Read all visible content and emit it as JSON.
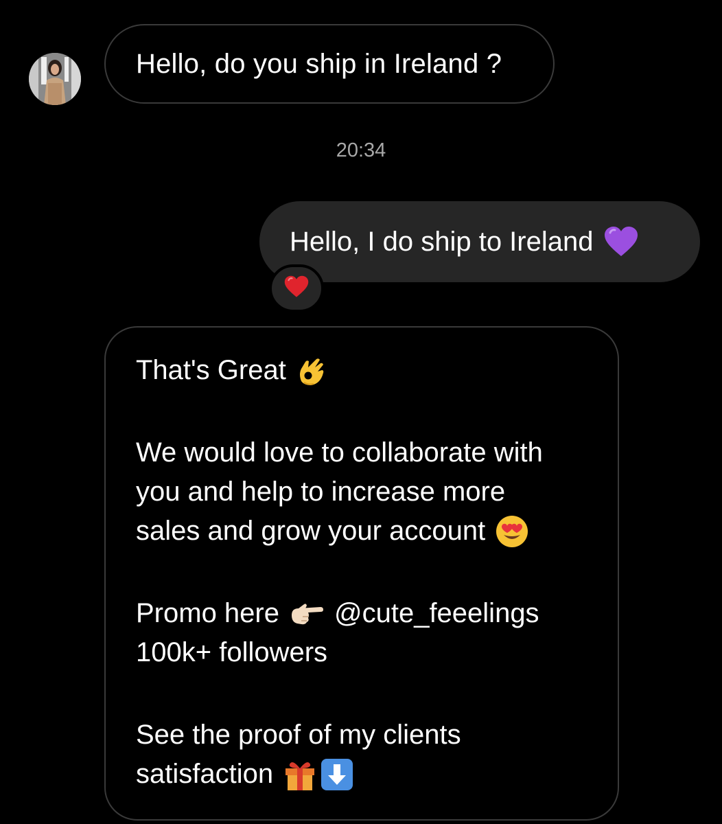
{
  "thread": {
    "message_1": {
      "text": "Hello, do you ship in Ireland ?"
    },
    "timestamp": "20:34",
    "reply_1": {
      "text": "Hello, I do ship to Ireland",
      "emoji_icon": "purple-heart-icon"
    },
    "reaction": {
      "emoji_icon": "red-heart-icon"
    },
    "message_2": {
      "line_1": "That's Great",
      "line_1_emoji": "ok-hand-icon",
      "para_2_line_1": "We would love to collaborate with",
      "para_2_line_2": "you and help to increase more",
      "para_2_line_3": "sales and grow your account",
      "para_2_emoji": "heart-eyes-icon",
      "para_3_line_1": "Promo here",
      "para_3_emoji": "pointing-right-icon",
      "mention": "@cute_feeelings",
      "para_3_line_2": "100k+ followers",
      "para_4_line_1": "See the proof of my clients",
      "para_4_line_2": "satisfaction",
      "para_4_emojis": [
        "gift-icon",
        "down-arrow-icon"
      ]
    }
  },
  "colors": {
    "background": "#000000",
    "outgoing_bubble": "#262626",
    "incoming_border": "#3a3a3a",
    "timestamp": "#a8a8a8",
    "text": "#ffffff"
  }
}
